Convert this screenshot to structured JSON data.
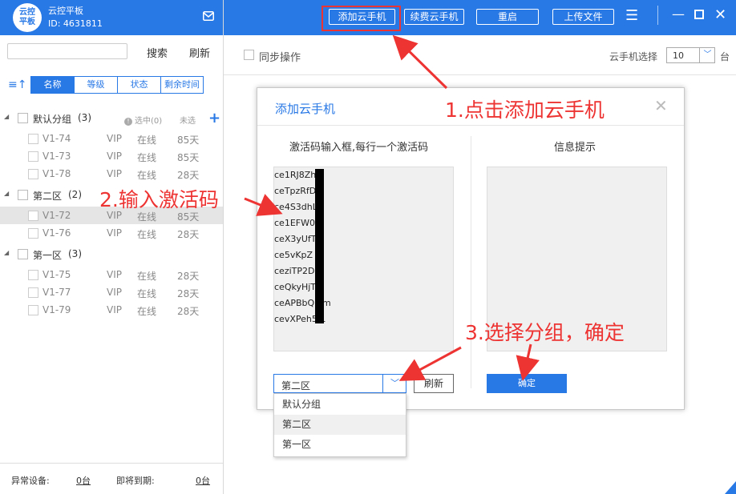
{
  "app": {
    "logo_line1": "云控",
    "logo_line2": "平板",
    "title": "云控平板",
    "id": "ID: 4631811"
  },
  "left": {
    "search_placeholder": "",
    "search_label": "搜索",
    "refresh_label": "刷新",
    "sort_tabs": [
      {
        "label": "名称",
        "active": true
      },
      {
        "label": "等级",
        "active": false
      },
      {
        "label": "状态",
        "active": false
      },
      {
        "label": "剩余时间",
        "active": false
      }
    ],
    "selected_info": "选中(0)",
    "unselected_info": "未选",
    "groups": [
      {
        "name": "默认分组",
        "count": "(3)",
        "devices": [
          {
            "name": "V1-74",
            "level": "VIP",
            "status": "在线",
            "time": "85天"
          },
          {
            "name": "V1-73",
            "level": "VIP",
            "status": "在线",
            "time": "85天"
          },
          {
            "name": "V1-78",
            "level": "VIP",
            "status": "在线",
            "time": "28天"
          }
        ]
      },
      {
        "name": "第二区",
        "count": "(2)",
        "devices": [
          {
            "name": "V1-72",
            "level": "VIP",
            "status": "在线",
            "time": "85天"
          },
          {
            "name": "V1-76",
            "level": "VIP",
            "status": "在线",
            "time": "28天"
          }
        ]
      },
      {
        "name": "第一区",
        "count": "(3)",
        "devices": [
          {
            "name": "V1-75",
            "level": "VIP",
            "status": "在线",
            "time": "28天"
          },
          {
            "name": "V1-77",
            "level": "VIP",
            "status": "在线",
            "time": "28天"
          },
          {
            "name": "V1-79",
            "level": "VIP",
            "status": "在线",
            "time": "28天"
          }
        ]
      }
    ],
    "footer": {
      "abnormal_label": "异常设备:",
      "abnormal_value": "0台",
      "expiring_label": "即将到期:",
      "expiring_value": "0台"
    }
  },
  "toolbar": {
    "add_phone": "添加云手机",
    "renew_phone": "续费云手机",
    "restart": "重启",
    "upload": "上传文件"
  },
  "content": {
    "sync_label": "同步操作",
    "phone_select_label": "云手机选择",
    "phone_count": "10",
    "unit": "台"
  },
  "dialog": {
    "title": "添加云手机",
    "code_heading": "激活码输入框,每行一个激活码",
    "info_heading": "信息提示",
    "codes": [
      "ce1RJ8Zh",
      "ceTpzRfD",
      "ce4S3dhL6",
      "ce1EFW0",
      "ceX3yUfT",
      "ce5vKpZ",
      "ceziTP2D",
      "ceQkyHjT8",
      "ceAPBbQ  Fm",
      "cevXPeh5  L"
    ],
    "group_value": "第二区",
    "refresh_label": "刷新",
    "confirm_label": "确定",
    "dropdown_options": [
      "默认分组",
      "第二区",
      "第一区"
    ]
  },
  "annotations": {
    "step1": "1.点击添加云手机",
    "step2": "2.输入激活码",
    "step3": "3.选择分组，确定"
  },
  "colors": {
    "brand_blue": "#2878e6",
    "annotation_red": "#e33"
  }
}
